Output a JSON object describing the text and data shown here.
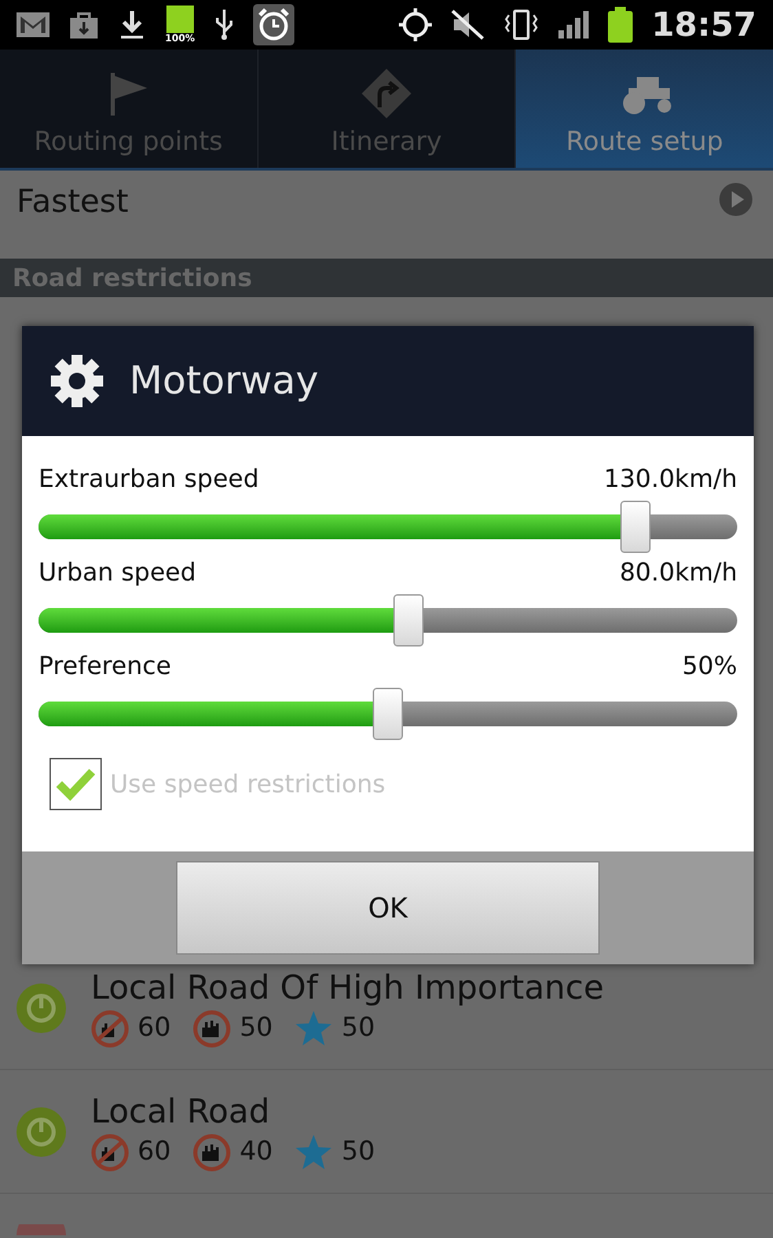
{
  "status_bar": {
    "battery_badge": "100%",
    "time": "18:57"
  },
  "tabs": [
    {
      "label": "Routing points",
      "kind": "flag",
      "selected": false
    },
    {
      "label": "Itinerary",
      "kind": "turn",
      "selected": false
    },
    {
      "label": "Route setup",
      "kind": "tractor",
      "selected": true
    }
  ],
  "route_type": {
    "label": "Fastest"
  },
  "section_header": "Road restrictions",
  "roads": [
    {
      "name": "Local Road Of High Importance",
      "enabled": true,
      "restrictions": [
        {
          "kind": "extraurban",
          "value": "60"
        },
        {
          "kind": "urban",
          "value": "50"
        },
        {
          "kind": "preference",
          "value": "50"
        }
      ]
    },
    {
      "name": "Local Road",
      "enabled": true,
      "restrictions": [
        {
          "kind": "extraurban",
          "value": "60"
        },
        {
          "kind": "urban",
          "value": "40"
        },
        {
          "kind": "preference",
          "value": "50"
        }
      ]
    }
  ],
  "dialog": {
    "title": "Motorway",
    "sliders": [
      {
        "label": "Extraurban speed",
        "reading": "130.0km/h",
        "level": 0.855
      },
      {
        "label": "Urban speed",
        "reading": "80.0km/h",
        "level": 0.53
      },
      {
        "label": "Preference",
        "reading": "50%",
        "level": 0.5
      }
    ],
    "checkbox": {
      "label": "Use speed restrictions",
      "checked": true,
      "disabled": true
    },
    "buttons": [
      "OK"
    ]
  }
}
